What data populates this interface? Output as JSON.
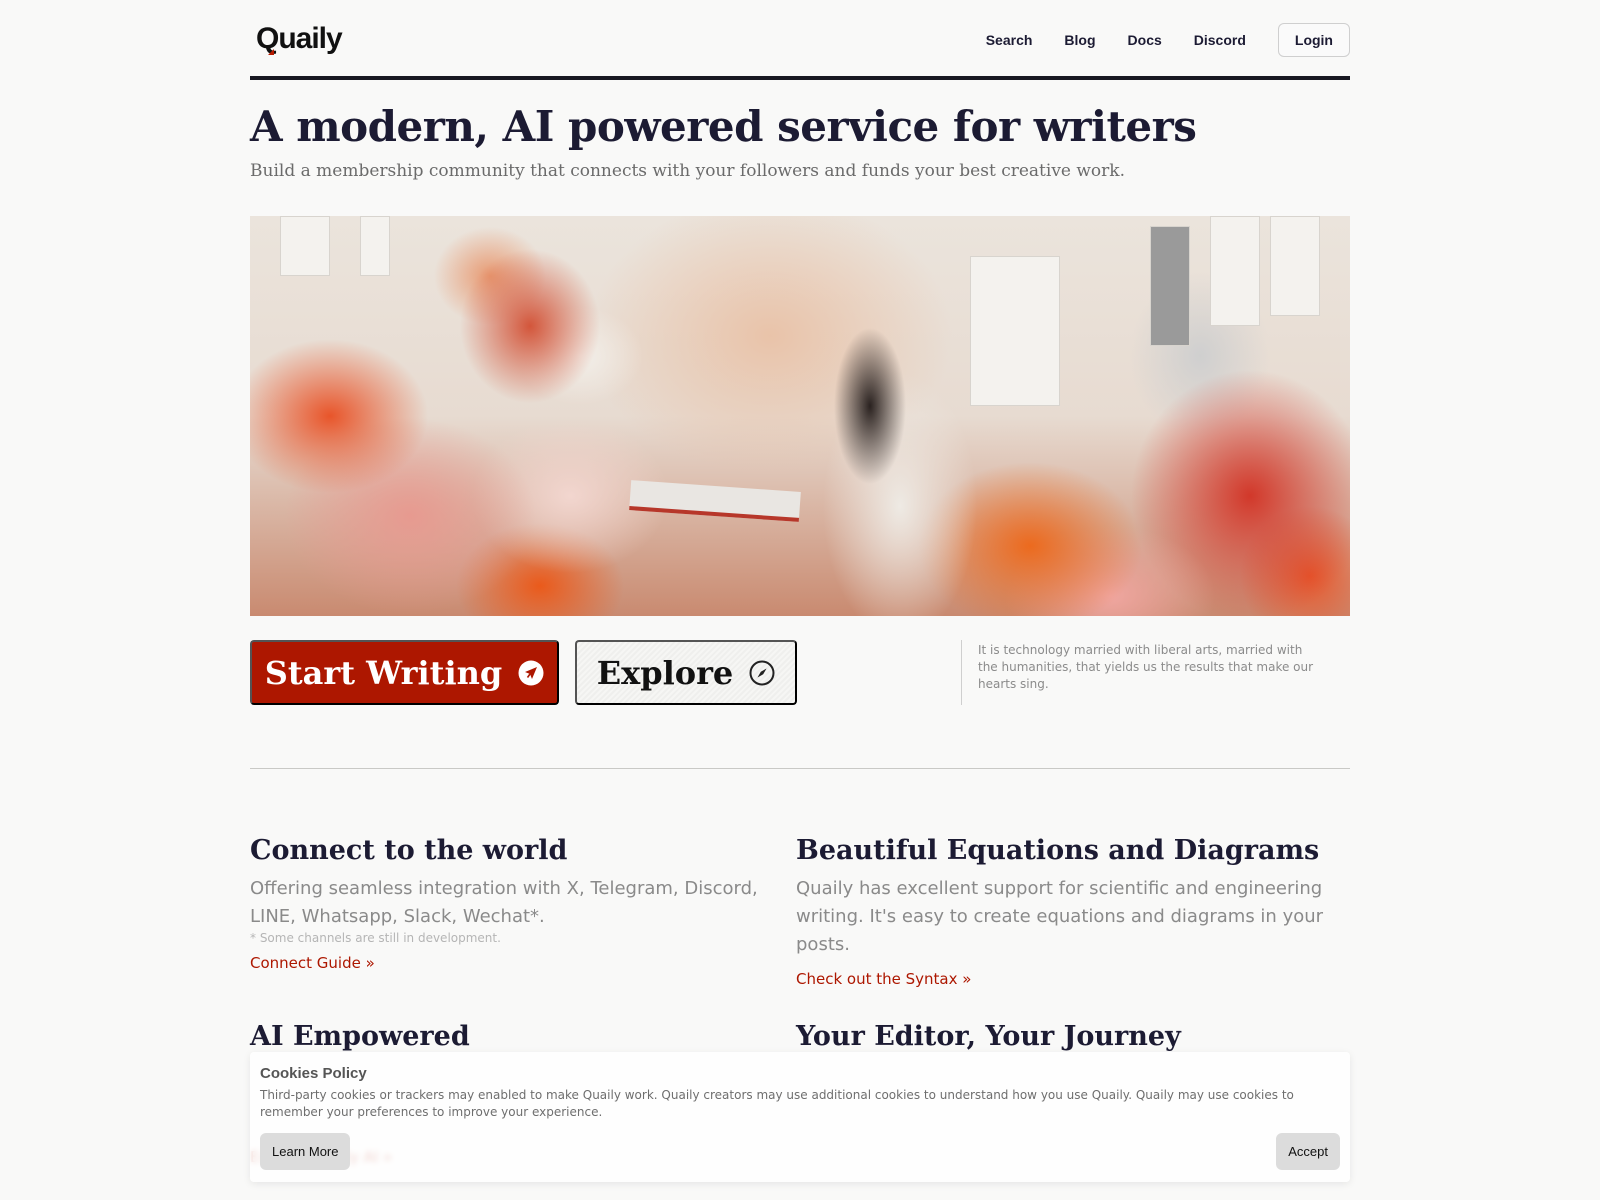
{
  "header": {
    "logo": "Quaily",
    "nav": [
      {
        "label": "Search"
      },
      {
        "label": "Blog"
      },
      {
        "label": "Docs"
      },
      {
        "label": "Discord"
      }
    ],
    "login_label": "Login"
  },
  "hero": {
    "title": "A modern, AI powered service for writers",
    "subtitle": "Build a membership community that connects with your followers and funds your best creative work.",
    "image_alt": "Woman writing at a desk surrounded by flowers and pinned papers",
    "start_writing_label": "Start Writing",
    "start_writing_icon": "paper-plane-icon",
    "explore_label": "Explore",
    "explore_icon": "compass-icon",
    "quote": "It is technology married with liberal arts, married with the humanities, that yields us the results that make our hearts sing."
  },
  "features": [
    {
      "title": "Connect to the world",
      "description": "Offering seamless integration with X, Telegram, Discord, LINE, Whatsapp, Slack, Wechat*.",
      "note": "* Some channels are still in development.",
      "link": "Connect Guide »"
    },
    {
      "title": "Beautiful Equations and Diagrams",
      "description": "Quaily has excellent support for scientific and engineering writing. It's easy to create equations and diagrams in your posts.",
      "link": "Check out the Syntax »"
    },
    {
      "title": "AI Empowered",
      "link": "Explore Quaily AI »"
    },
    {
      "title": "Your Editor, Your Journey"
    }
  ],
  "cookie_banner": {
    "title": "Cookies Policy",
    "text": "Third-party cookies or trackers may enabled to make Quaily work. Quaily creators may use additional cookies to understand how you use Quaily. Quaily may use cookies to remember your preferences to improve your experience.",
    "learn_more_label": "Learn More",
    "accept_label": "Accept"
  },
  "colors": {
    "brand_red": "#ad1700",
    "heading": "#1c1b33",
    "background": "#f9f9f8"
  }
}
